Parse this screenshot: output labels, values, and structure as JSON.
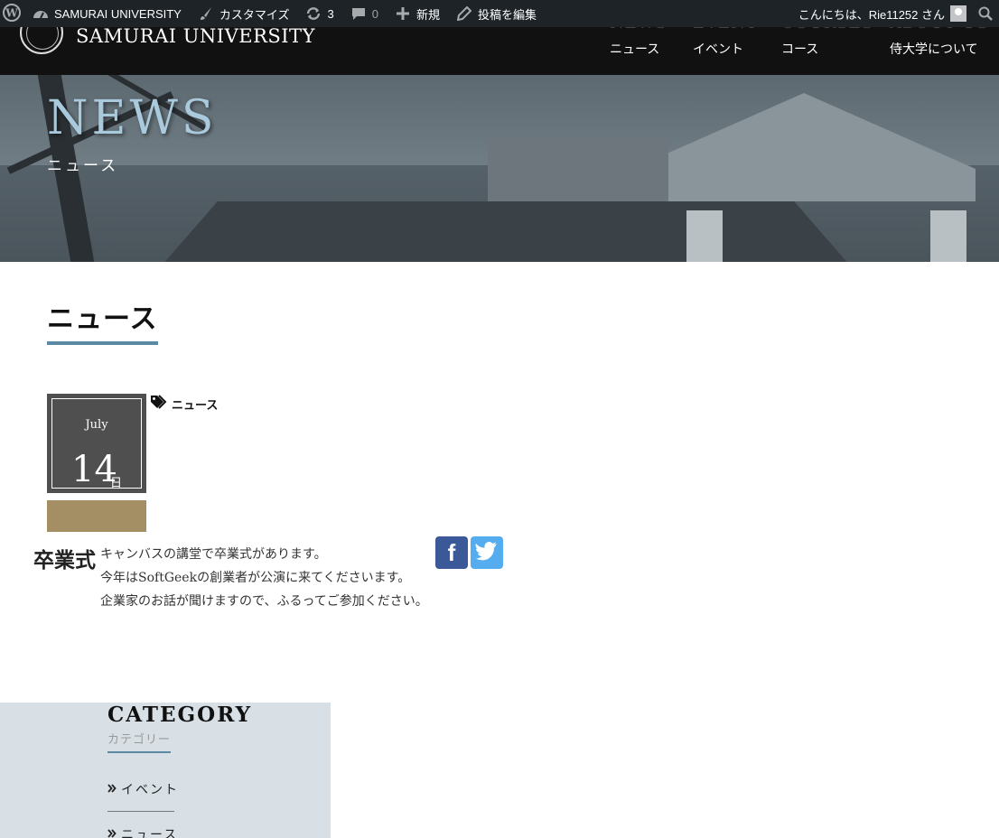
{
  "admin_bar": {
    "site_name": "SAMURAI UNIVERSITY",
    "customize": "カスタマイズ",
    "updates_count": "3",
    "comments_count": "0",
    "new_label": "新規",
    "edit_post": "投稿を編集",
    "greeting": "こんにちは、Rie11252 さん"
  },
  "header": {
    "site_title": "SAMURAI UNIVERSITY",
    "nav": [
      {
        "en": "NEWS",
        "ja": "ニュース"
      },
      {
        "en": "EVENT",
        "ja": "イベント"
      },
      {
        "en": "COURSES",
        "ja": "コース"
      },
      {
        "en": "ABOUT US",
        "ja": "侍大学について"
      }
    ]
  },
  "hero": {
    "title": "NEWS",
    "subtitle": "ニュース"
  },
  "page": {
    "heading": "ニュース"
  },
  "post": {
    "month": "July",
    "day": "14",
    "day_suffix": "日",
    "tag": "ニュース",
    "title": "卒業式",
    "body": [
      "キャンバスの講堂で卒業式があります。",
      "今年はSoftGeekの創業者が公演に来てくださいます。",
      "企業家のお話が聞けますので、ふるってご参加ください。"
    ],
    "share": {
      "facebook": "f"
    }
  },
  "sidebar": {
    "title": "CATEGORY",
    "subtitle": "カテゴリー",
    "items": [
      "イベント",
      "ニュース"
    ]
  },
  "colors": {
    "accent": "#5d8aa3",
    "gold": "#a38f63",
    "facebook": "#3b5998",
    "twitter": "#55acee"
  }
}
